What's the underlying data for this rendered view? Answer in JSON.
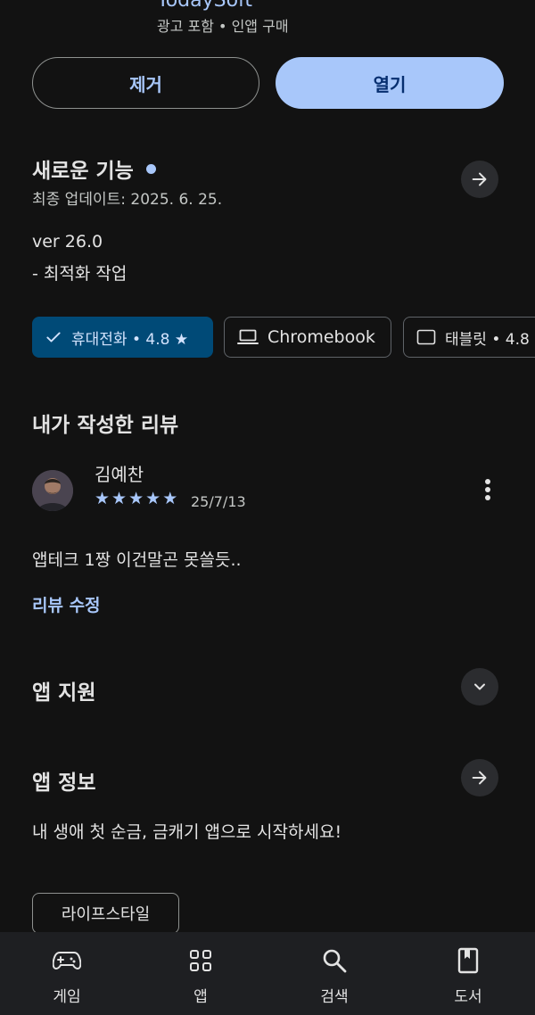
{
  "app": {
    "developer": "TodaySoft",
    "subline": "광고 포함 • 인앱 구매"
  },
  "actions": {
    "uninstall_label": "제거",
    "open_label": "열기"
  },
  "whats_new": {
    "title": "새로운 기능",
    "updated": "최종 업데이트: 2025. 6. 25.",
    "version": "ver 26.0",
    "note": "- 최적화 작업"
  },
  "device_chips": [
    {
      "label": "휴대전화 • 4.8 ★",
      "icon": "check-icon",
      "selected": true
    },
    {
      "label": "Chromebook",
      "icon": "laptop-icon",
      "selected": false
    },
    {
      "label": "태블릿 • 4.8",
      "icon": "tablet-icon",
      "selected": false
    }
  ],
  "my_review": {
    "title": "내가 작성한 리뷰",
    "author": "김예찬",
    "rating": 5,
    "date": "25/7/13",
    "text": "앱테크 1짱 이건말곤 못쓸듯..",
    "edit_label": "리뷰 수정"
  },
  "app_support": {
    "title": "앱 지원"
  },
  "app_info": {
    "title": "앱 정보",
    "description": "내 생애 첫 순금, 금캐기 앱으로 시작하세요!",
    "category_tag": "라이프스타일"
  },
  "bottom_nav": [
    {
      "label": "게임",
      "icon": "gamepad-icon"
    },
    {
      "label": "앱",
      "icon": "apps-grid-icon"
    },
    {
      "label": "검색",
      "icon": "search-icon"
    },
    {
      "label": "도서",
      "icon": "book-icon"
    }
  ],
  "colors": {
    "background": "#121212",
    "accent": "#a8c7fa",
    "chip_selected_bg": "#004a77",
    "text_primary": "#e3e3e3"
  }
}
